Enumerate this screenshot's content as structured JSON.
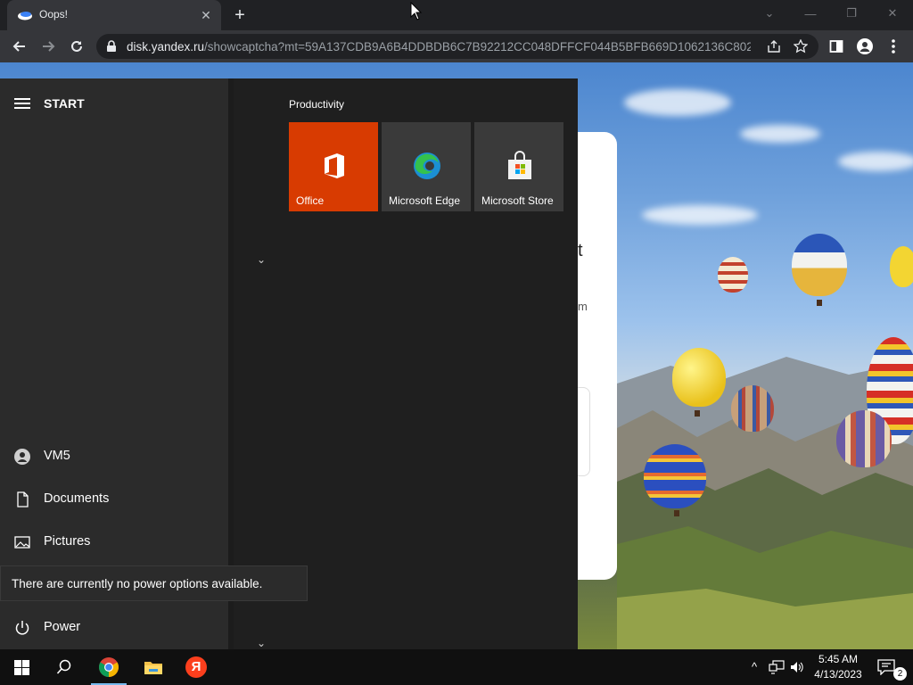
{
  "browser": {
    "tab": {
      "title": "Oops!"
    },
    "new_tab_label": "+",
    "address": {
      "host": "disk.yandex.ru",
      "path": "/showcaptcha?mt=59A137CDB9A6B4DDBDB6C7B92212CC048DFFCF044B5BFB669D1062136C802..."
    }
  },
  "captcha_fragments": {
    "frag1": "t",
    "frag2": "m"
  },
  "start_menu": {
    "header": "START",
    "group_title": "Productivity",
    "tiles": [
      {
        "label": "Office",
        "color": "#d83b01"
      },
      {
        "label": "Microsoft Edge",
        "color": "#3a3a3a"
      },
      {
        "label": "Microsoft Store",
        "color": "#3a3a3a"
      }
    ],
    "left_items": {
      "user": "VM5",
      "documents": "Documents",
      "pictures": "Pictures",
      "power": "Power"
    },
    "power_tooltip": "There are currently no power options available."
  },
  "taskbar": {
    "clock_time": "5:45 AM",
    "clock_date": "4/13/2023",
    "notification_count": "2",
    "yandex_letter": "Я"
  }
}
